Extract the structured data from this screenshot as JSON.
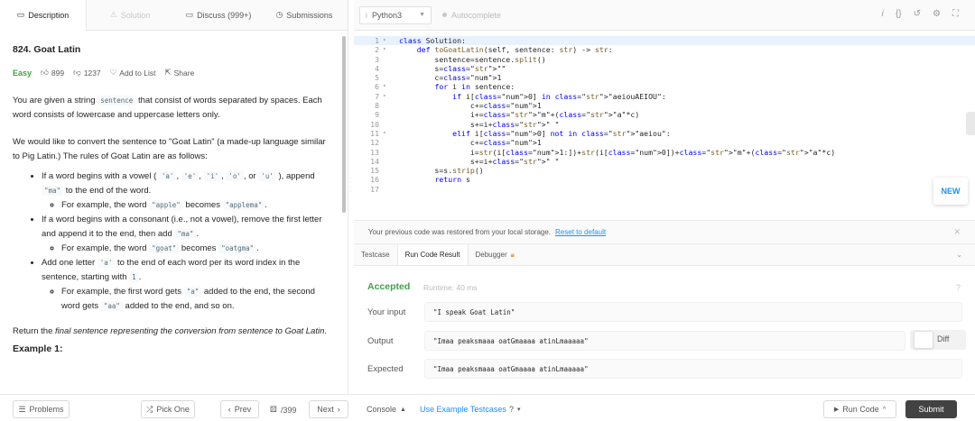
{
  "left_tabs": [
    {
      "icon": "▭",
      "label": "Description"
    },
    {
      "icon": "⚠",
      "label": "Solution"
    },
    {
      "icon": "▭",
      "label": "Discuss (999+)"
    },
    {
      "icon": "◷",
      "label": "Submissions"
    }
  ],
  "problem": {
    "title": "824. Goat Latin",
    "difficulty": "Easy",
    "likes": "899",
    "dislikes": "1237",
    "add_to_list": "Add to List",
    "share": "Share",
    "intro_a": "You are given a string ",
    "intro_code": "sentence",
    "intro_b": " that consist of words separated by spaces. Each word consists of lowercase and uppercase letters only.",
    "para2": "We would like to convert the sentence to \"Goat Latin\" (a made-up language similar to Pig Latin.) The rules of Goat Latin are as follows:",
    "r1_a": "If a word begins with a vowel (",
    "r1_c1": "'a'",
    "r1_c2": "'e'",
    "r1_c3": "'i'",
    "r1_c4": "'o'",
    "r1_or": ", or ",
    "r1_c5": "'u'",
    "r1_b": "), append ",
    "r1_c6": "\"ma\"",
    "r1_e": " to the end of the word.",
    "r1s_a": "For example, the word ",
    "r1s_c1": "\"apple\"",
    "r1s_b": " becomes ",
    "r1s_c2": "\"applema\"",
    "r1s_e": ".",
    "r2_a": "If a word begins with a consonant (i.e., not a vowel), remove the first letter and append it to the end, then add ",
    "r2_c1": "\"ma\"",
    "r2_e": ".",
    "r2s_a": "For example, the word ",
    "r2s_c1": "\"goat\"",
    "r2s_b": " becomes ",
    "r2s_c2": "\"oatgma\"",
    "r2s_e": ".",
    "r3_a": "Add one letter ",
    "r3_c1": "'a'",
    "r3_b": " to the end of each word per its word index in the sentence, starting with ",
    "r3_c2": "1",
    "r3_e": ".",
    "r3s_a": "For example, the first word gets ",
    "r3s_c1": "\"a\"",
    "r3s_b": " added to the end, the second word gets ",
    "r3s_c2": "\"aa\"",
    "r3s_e": " added to the end, and so on.",
    "return_a": "Return the ",
    "return_em": "final sentence representing the conversion from sentence to Goat Latin",
    "return_e": ".",
    "example_heading": "Example 1:"
  },
  "editor": {
    "language": "Python3",
    "autocomplete": "Autocomplete",
    "code_lines": [
      "class Solution:",
      "    def toGoatLatin(self, sentence: str) -> str:",
      "        sentence=sentence.split()",
      "        s=\"\"",
      "        c=1",
      "        for i in sentence:",
      "            if i[0] in \"aeiouAEIOU\":",
      "                c+=1",
      "                i+=\"m\"+(\"a\"*c)",
      "                s+=i+\" \"",
      "            elif i[0] not in \"aeiou\":",
      "                c+=1",
      "                i=str(i[1:])+str(i[0])+\"m\"+(\"a\"*c)",
      "                s+=i+\" \"",
      "        s=s.strip()",
      "        return s",
      ""
    ],
    "new_badge": "NEW"
  },
  "restore": {
    "message": "Your previous code was restored from your local storage.",
    "reset_link": "Reset to default"
  },
  "console_tabs": [
    "Testcase",
    "Run Code Result",
    "Debugger"
  ],
  "result": {
    "status": "Accepted",
    "runtime": "Runtime: 40 ms",
    "input_label": "Your input",
    "input_value": "\"I speak Goat Latin\"",
    "output_label": "Output",
    "output_value": "\"Imaa peaksmaaa oatGmaaaa atinLmaaaaa\"",
    "expected_label": "Expected",
    "expected_value": "\"Imaa peaksmaaa oatGmaaaa atinLmaaaaa\"",
    "diff_label": "Diff"
  },
  "bottom": {
    "problems": "Problems",
    "pick_one": "Pick One",
    "prev": "Prev",
    "page": "/399",
    "next": "Next",
    "console": "Console",
    "use_example": "Use Example Testcases",
    "run_code": "Run Code",
    "submit": "Submit"
  },
  "colors": {
    "accepted": "#43a047",
    "link": "#1a90ff",
    "submit_bg": "#424242"
  }
}
